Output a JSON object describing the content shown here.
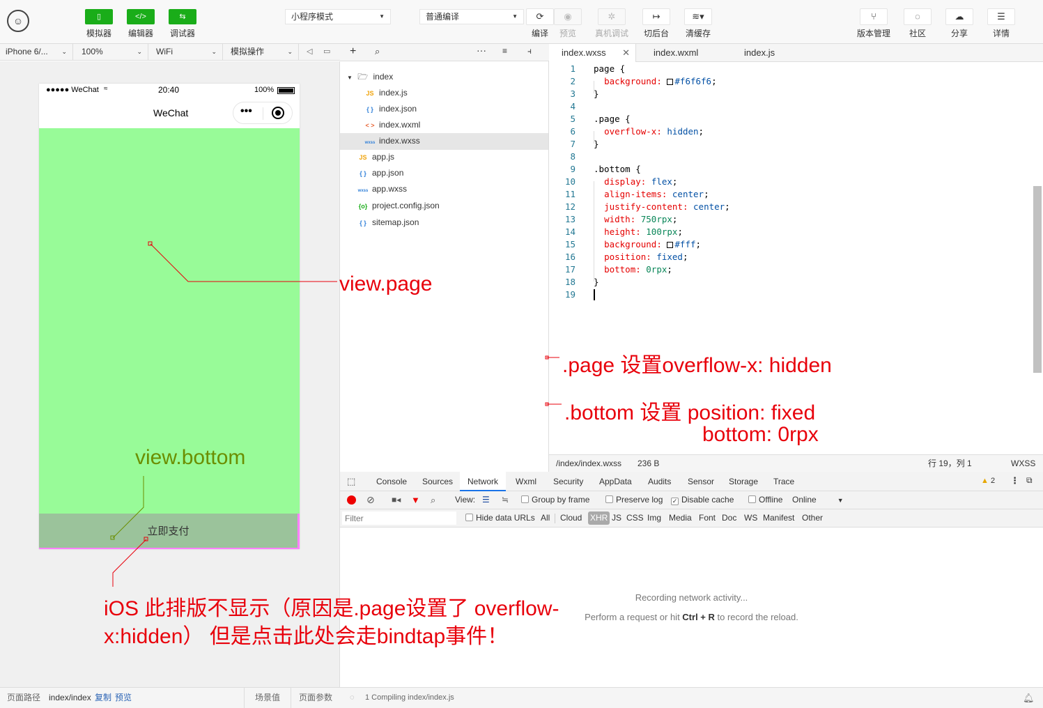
{
  "toolbar": {
    "simulator_label": "模拟器",
    "editor_label": "编辑器",
    "debugger_label": "调试器",
    "mode_select": "小程序模式",
    "compile_select": "普通编译",
    "compile_label": "编译",
    "preview_label": "预览",
    "device_debug_label": "真机调试",
    "backend_label": "切后台",
    "clear_cache_label": "清缓存",
    "version_label": "版本管理",
    "community_label": "社区",
    "share_label": "分享",
    "details_label": "详情"
  },
  "simbar": {
    "device": "iPhone 6/...",
    "zoom": "100%",
    "network": "WiFi",
    "operate": "模拟操作"
  },
  "phone": {
    "carrier": "●●●●● WeChat",
    "time": "20:40",
    "battery": "100%",
    "nav_title": "WeChat",
    "bottom_button": "立即支付"
  },
  "simfoot": {
    "path_label": "页面路径",
    "path": "index/index",
    "copy": "复制",
    "preview": "预览",
    "scene": "场景值",
    "params": "页面参数"
  },
  "tree": {
    "folder": "index",
    "files": [
      {
        "icon": "JS",
        "name": "index.js",
        "color": "#f0a30a"
      },
      {
        "icon": "{ }",
        "name": "index.json",
        "color": "#2f7fd8"
      },
      {
        "icon": "< >",
        "name": "index.wxml",
        "color": "#e8683a"
      },
      {
        "icon": "wxss",
        "name": "index.wxss",
        "color": "#2f7fd8"
      },
      {
        "icon": "JS",
        "name": "app.js",
        "color": "#f0a30a"
      },
      {
        "icon": "{ }",
        "name": "app.json",
        "color": "#2f7fd8"
      },
      {
        "icon": "wxss",
        "name": "app.wxss",
        "color": "#2f7fd8"
      },
      {
        "icon": "{o}",
        "name": "project.config.json",
        "color": "#1aad19"
      },
      {
        "icon": "{ }",
        "name": "sitemap.json",
        "color": "#2f7fd8"
      }
    ]
  },
  "editor": {
    "tabs": [
      "index.wxss",
      "index.wxml",
      "index.js"
    ],
    "lines": [
      "1",
      "2",
      "3",
      "4",
      "5",
      "6",
      "7",
      "8",
      "9",
      "10",
      "11",
      "12",
      "13",
      "14",
      "15",
      "16",
      "17",
      "18",
      "19"
    ],
    "status_path": "/index/index.wxss",
    "status_size": "236 B",
    "status_pos": "行 19，列 1",
    "status_lang": "WXSS"
  },
  "devtools": {
    "tabs": [
      "Console",
      "Sources",
      "Network",
      "Wxml",
      "Security",
      "AppData",
      "Audits",
      "Sensor",
      "Storage",
      "Trace"
    ],
    "warn_count": "2",
    "view_label": "View:",
    "group_by_frame": "Group by frame",
    "preserve_log": "Preserve log",
    "disable_cache": "Disable cache",
    "offline": "Offline",
    "online": "Online",
    "filter_placeholder": "Filter",
    "hide_data_urls": "Hide data URLs",
    "filter_types": [
      "All",
      "Cloud",
      "XHR",
      "JS",
      "CSS",
      "Img",
      "Media",
      "Font",
      "Doc",
      "WS",
      "Manifest",
      "Other"
    ],
    "recording": "Recording network activity...",
    "hint_prefix": "Perform a request or hit ",
    "hint_key": "Ctrl + R",
    "hint_suffix": " to record the reload.",
    "compiling": "1 Compiling index/index.js"
  },
  "annotations": {
    "view_page": "view.page",
    "view_bottom": "view.bottom",
    "page_note": ".page 设置overflow-x: hidden",
    "bottom_note1": ".bottom 设置 position: fixed",
    "bottom_note2": "bottom: 0rpx",
    "ios_note1": "iOS 此排版不显示（原因是.page设置了 overflow-",
    "ios_note2": "x:hidden）  但是点击此处会走bindtap事件！"
  },
  "colors": {
    "accent_green": "#1aad19",
    "page_bg": "#98fb98",
    "bottom_bg": "#9bc39b",
    "annotation_red": "#e8000b",
    "annotation_olive": "#6b8e00"
  }
}
